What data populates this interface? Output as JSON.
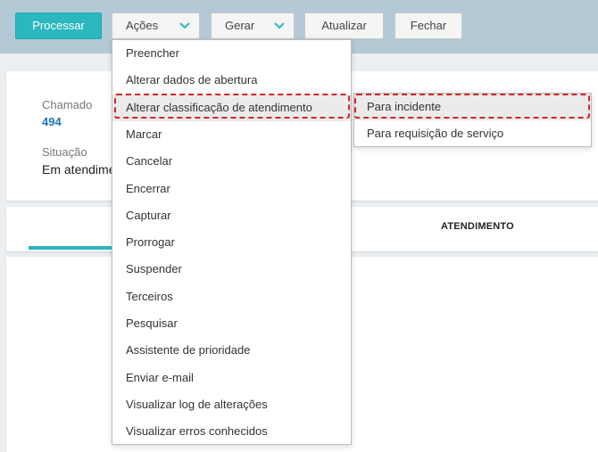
{
  "toolbar": {
    "process_label": "Processar",
    "actions_label": "Ações",
    "generate_label": "Gerar",
    "update_label": "Atualizar",
    "close_label": "Fechar",
    "chevron_icon": "chevron-down-icon"
  },
  "details": {
    "ticket_label": "Chamado",
    "ticket_value": "494",
    "status_label": "Situação",
    "status_value": "Em atendime"
  },
  "tabs": {
    "service_tab_label": "ATENDIMENTO"
  },
  "actions_menu": {
    "items": [
      "Preencher",
      "Alterar dados de abertura",
      "Alterar classificação de atendimento",
      "Marcar",
      "Cancelar",
      "Encerrar",
      "Capturar",
      "Prorrogar",
      "Suspender",
      "Terceiros",
      "Pesquisar",
      "Assistente de prioridade",
      "Enviar e-mail",
      "Visualizar log de alterações",
      "Visualizar erros conhecidos"
    ],
    "highlighted_index": 2
  },
  "classification_submenu": {
    "items": [
      "Para incidente",
      "Para requisição de serviço"
    ],
    "highlighted_index": 0
  },
  "colors": {
    "accent": "#2ab7bd",
    "toolbar_bg": "#b3cad6",
    "link": "#1e74b8",
    "annotation": "#d0262a"
  }
}
